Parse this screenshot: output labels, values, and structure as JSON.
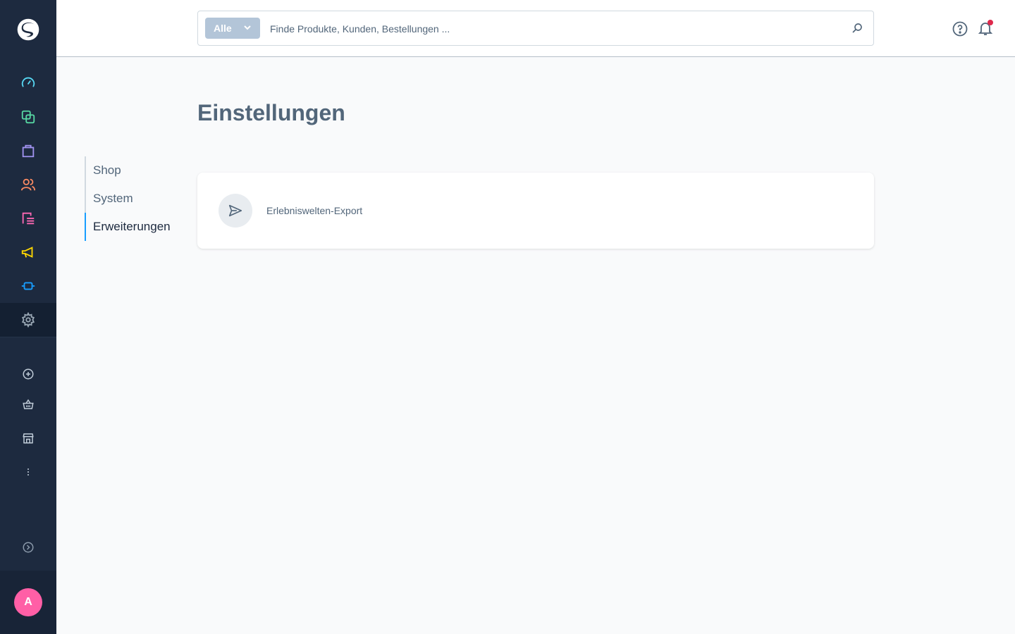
{
  "sidebar": {
    "logo": "shopware-logo",
    "items": [
      {
        "icon": "dashboard-icon",
        "color": "#57d9f4"
      },
      {
        "icon": "catalog-icon",
        "color": "#57d9a3"
      },
      {
        "icon": "orders-icon",
        "color": "#a092f0"
      },
      {
        "icon": "customers-icon",
        "color": "#f88962"
      },
      {
        "icon": "content-icon",
        "color": "#ff68b4"
      },
      {
        "icon": "marketing-icon",
        "color": "#ffd700"
      },
      {
        "icon": "extensions-icon",
        "color": "#189eff"
      },
      {
        "icon": "settings-icon",
        "color": "#9aa8b5",
        "active": true
      }
    ],
    "secondary": [
      "add-icon",
      "basket-icon",
      "storefront-icon",
      "more-icon"
    ],
    "collapse": "collapse-icon",
    "avatar_initial": "A",
    "avatar_color": "#ff5fa6"
  },
  "header": {
    "search_type": "Alle",
    "search_placeholder": "Finde Produkte, Kunden, Bestellungen ..."
  },
  "page": {
    "title": "Einstellungen"
  },
  "settings_nav": [
    {
      "label": "Shop",
      "active": false
    },
    {
      "label": "System",
      "active": false
    },
    {
      "label": "Erweiterungen",
      "active": true
    }
  ],
  "card": {
    "items": [
      {
        "label": "Erlebniswelten-Export",
        "icon": "paper-plane-icon"
      }
    ]
  }
}
